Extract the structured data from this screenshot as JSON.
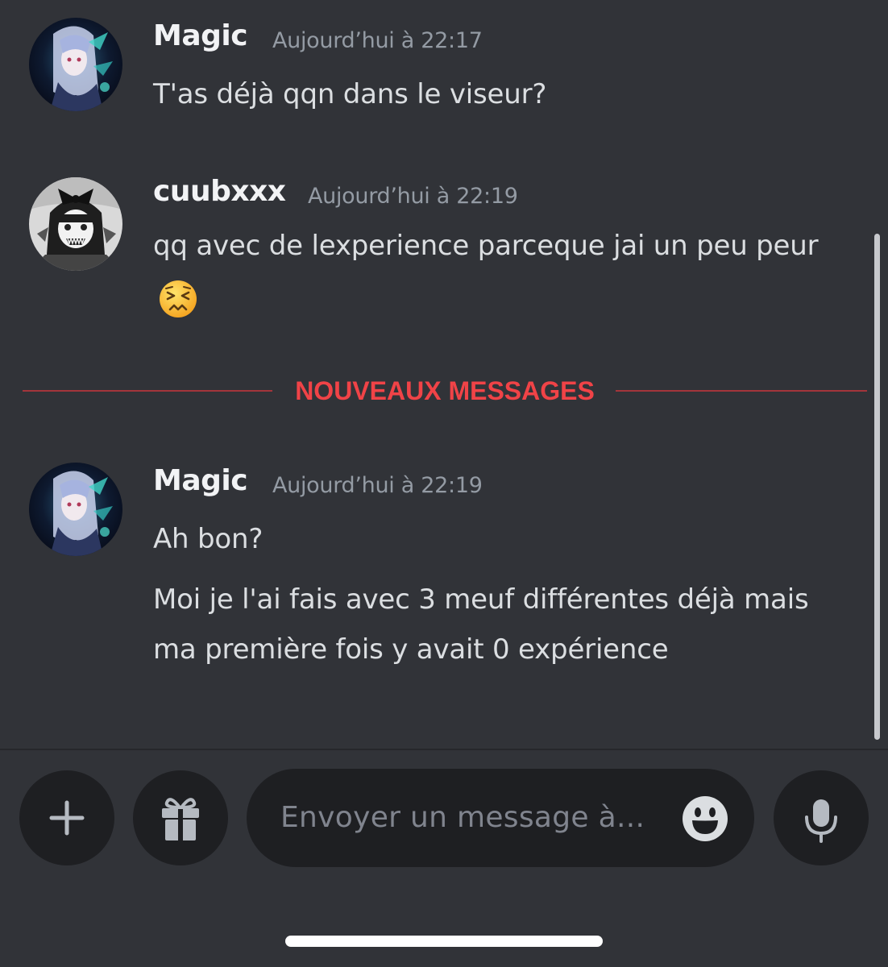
{
  "messages": [
    {
      "author": "Magic",
      "timestamp": "Aujourd’hui à 22:17",
      "lines": [
        "T'as déjà qqn dans le viseur?"
      ]
    },
    {
      "author": "cuubxxx",
      "timestamp": "Aujourd’hui à 22:19",
      "lines": [
        "qq avec de lexperience parceque jai un peu peur"
      ],
      "emoji": "persevering-face-emoji"
    },
    {
      "author": "Magic",
      "timestamp": "Aujourd’hui à 22:19",
      "lines": [
        "Ah bon?",
        "Moi je l'ai fais avec 3 meuf différentes déjà mais ma première fois y avait 0 expérience"
      ]
    }
  ],
  "divider": {
    "label": "NOUVEAUX MESSAGES"
  },
  "composer": {
    "placeholder": "Envoyer un message à...",
    "buttons": [
      "plus-icon",
      "gift-icon",
      "emoji-icon",
      "microphone-icon"
    ]
  },
  "colors": {
    "background": "#313338",
    "input_background": "#1e1f22",
    "divider": "#f04347",
    "author": "#f2f3f5",
    "timestamp": "#949ba4",
    "text": "#dbdee1"
  }
}
